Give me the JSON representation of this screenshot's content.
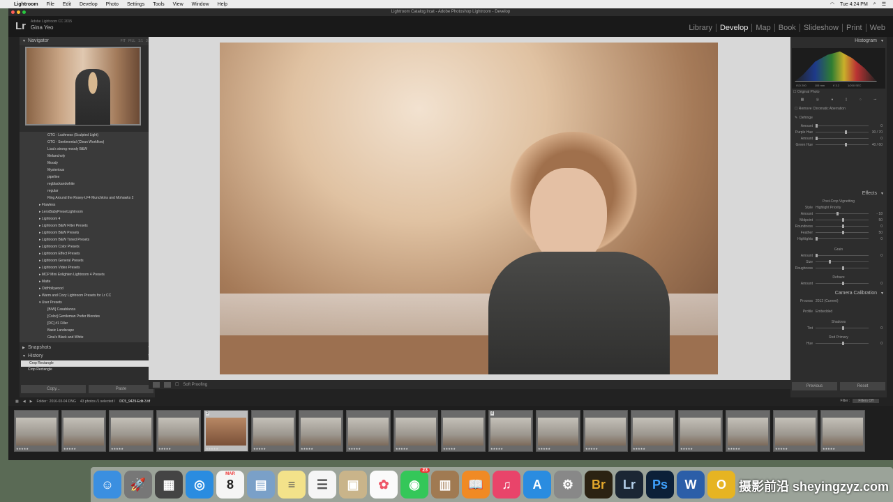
{
  "menubar": {
    "app": "Lightroom",
    "items": [
      "File",
      "Edit",
      "Develop",
      "Photo",
      "Settings",
      "Tools",
      "View",
      "Window",
      "Help"
    ],
    "clock": "Tue 4:24 PM"
  },
  "window_title": "Lightroom Catalog.lrcat - Adobe Photoshop Lightroom - Develop",
  "identity": {
    "logo": "Lr",
    "product": "Adobe Lightroom CC 2015",
    "user": "Gina Yeo"
  },
  "modules": [
    "Library",
    "Develop",
    "Map",
    "Book",
    "Slideshow",
    "Print",
    "Web"
  ],
  "navigator": {
    "title": "Navigator",
    "options": [
      "FIT",
      "FILL",
      "1:1",
      "3:1"
    ]
  },
  "presets": [
    {
      "label": "GTG - Lushness (Sculpted Light)",
      "kind": "sub"
    },
    {
      "label": "GTG - Sentimental (Clean Workflow)",
      "kind": "sub"
    },
    {
      "label": "Lisa's strong moody B&W",
      "kind": "sub"
    },
    {
      "label": "Melancholy",
      "kind": "sub"
    },
    {
      "label": "Moody",
      "kind": "sub"
    },
    {
      "label": "Mysterious",
      "kind": "sub"
    },
    {
      "label": "pipeline",
      "kind": "sub"
    },
    {
      "label": "regblackandwhite",
      "kind": "sub"
    },
    {
      "label": "regular",
      "kind": "sub"
    },
    {
      "label": "Ring Around the Rosey-LF4 Munchkins and Mohawks 2",
      "kind": "sub"
    },
    {
      "label": "▸ Flawless",
      "kind": "fld"
    },
    {
      "label": "▸ LensBabyPresetLightroom",
      "kind": "fld"
    },
    {
      "label": "▸ Lightroom 4",
      "kind": "fld"
    },
    {
      "label": "▸ Lightroom B&W Filter Presets",
      "kind": "fld"
    },
    {
      "label": "▸ Lightroom B&W Presets",
      "kind": "fld"
    },
    {
      "label": "▸ Lightroom B&W Toned Presets",
      "kind": "fld"
    },
    {
      "label": "▸ Lightroom Color Presets",
      "kind": "fld"
    },
    {
      "label": "▸ Lightroom Effect Presets",
      "kind": "fld"
    },
    {
      "label": "▸ Lightroom General Presets",
      "kind": "fld"
    },
    {
      "label": "▸ Lightroom Video Presets",
      "kind": "fld"
    },
    {
      "label": "▸ MCP Mini Enlighten Lightroom 4 Presets",
      "kind": "fld"
    },
    {
      "label": "▸ Matte",
      "kind": "fld"
    },
    {
      "label": "▸ OldHollywood",
      "kind": "fld"
    },
    {
      "label": "▸ Warm and Cozy Lightroom Presets for Lr CC",
      "kind": "fld"
    },
    {
      "label": "▾ User Presets",
      "kind": "fld"
    },
    {
      "label": "[B/W] Casablanca",
      "kind": "sub"
    },
    {
      "label": "[Color] Gentleman Prefer Blondes",
      "kind": "sub"
    },
    {
      "label": "[DC] #1 Filler",
      "kind": "sub"
    },
    {
      "label": "Basic Landscape",
      "kind": "sub"
    },
    {
      "label": "Gina's Black and White",
      "kind": "sub"
    }
  ],
  "snapshots": {
    "title": "Snapshots"
  },
  "history": {
    "title": "History",
    "items": [
      "Crop Rectangle",
      "Crop Rectangle"
    ]
  },
  "leftbuttons": {
    "copy": "Copy...",
    "paste": "Paste"
  },
  "toolbar": {
    "soft_proofing": "Soft Proofing"
  },
  "right": {
    "histogram_title": "Histogram",
    "histogram_info": [
      "ISO 200",
      "105 mm",
      "f/ 3.2",
      "1/200 SEC"
    ],
    "original_photo": "Original Photo",
    "remove_ca": "Remove Chromatic Aberration",
    "defringe": "Defringe",
    "defringe_rows": [
      {
        "label": "Amount",
        "value": "0",
        "pos": 0
      },
      {
        "label": "Purple Hue",
        "value": "30 / 70",
        "pos": 55
      },
      {
        "label": "Amount",
        "value": "0",
        "pos": 0
      },
      {
        "label": "Green Hue",
        "value": "40 / 60",
        "pos": 55
      }
    ],
    "effects_title": "Effects",
    "vignette_title": "Post-Crop Vignetting",
    "vignette_style_label": "Style",
    "vignette_style": "Highlight Priority",
    "vignette_rows": [
      {
        "label": "Amount",
        "value": "- 18",
        "pos": 40
      },
      {
        "label": "Midpoint",
        "value": "50",
        "pos": 50
      },
      {
        "label": "Roundness",
        "value": "0",
        "pos": 50
      },
      {
        "label": "Feather",
        "value": "50",
        "pos": 50
      },
      {
        "label": "Highlights",
        "value": "0",
        "pos": 0
      }
    ],
    "grain_title": "Grain",
    "grain_rows": [
      {
        "label": "Amount",
        "value": "0",
        "pos": 0
      },
      {
        "label": "Size",
        "value": "",
        "pos": 25
      },
      {
        "label": "Roughness",
        "value": "",
        "pos": 50
      }
    ],
    "dehaze_title": "Dehaze",
    "dehaze_row": {
      "label": "Amount",
      "value": "0",
      "pos": 50
    },
    "calibration_title": "Camera Calibration",
    "process_label": "Process",
    "process": "2012 (Current)",
    "profile_label": "Profile",
    "profile": "Embedded",
    "shadows_title": "Shadows",
    "tint_row": {
      "label": "Tint",
      "value": "0",
      "pos": 50
    },
    "red_primary": "Red Primary",
    "hue_row": {
      "label": "Hue",
      "value": "0",
      "pos": 50
    },
    "previous": "Previous",
    "reset": "Reset"
  },
  "filmbar": {
    "folder": "Folder : 2016-03-04 DNG",
    "count": "43 photos /1 selected /",
    "filename": "DC5_9429-Edit-3.tif",
    "filter_label": "Filter :",
    "filter_value": "Filters Off"
  },
  "filmstrip": {
    "stars": "★★★★★",
    "thumbs": [
      {
        "num": ""
      },
      {
        "num": ""
      },
      {
        "num": ""
      },
      {
        "num": ""
      },
      {
        "num": "2",
        "active": true
      },
      {
        "num": ""
      },
      {
        "num": ""
      },
      {
        "num": ""
      },
      {
        "num": ""
      },
      {
        "num": ""
      },
      {
        "num": "4"
      },
      {
        "num": ""
      },
      {
        "num": ""
      },
      {
        "num": ""
      },
      {
        "num": ""
      },
      {
        "num": ""
      },
      {
        "num": ""
      },
      {
        "num": ""
      }
    ]
  },
  "dock": {
    "apps": [
      {
        "name": "finder-icon",
        "glyph": "☺",
        "color": "#3b8fe0"
      },
      {
        "name": "launchpad-icon",
        "glyph": "🚀",
        "color": "#777"
      },
      {
        "name": "mission-control-icon",
        "glyph": "▦",
        "color": "#444"
      },
      {
        "name": "safari-icon",
        "glyph": "◎",
        "color": "#2a8ce0"
      },
      {
        "name": "calendar-icon",
        "glyph": "8",
        "color": "#f5f5f5",
        "text": "#222",
        "label": "MAR"
      },
      {
        "name": "preview-icon",
        "glyph": "▤",
        "color": "#7aa0c8"
      },
      {
        "name": "notes-icon",
        "glyph": "≡",
        "color": "#f3e28a",
        "text": "#555"
      },
      {
        "name": "reminders-icon",
        "glyph": "☰",
        "color": "#f5f5f5",
        "text": "#555"
      },
      {
        "name": "contacts-icon",
        "glyph": "▣",
        "color": "#c9b48a"
      },
      {
        "name": "photos-icon",
        "glyph": "✿",
        "color": "#fafafa",
        "text": "#e56"
      },
      {
        "name": "facetime-icon",
        "glyph": "◉",
        "color": "#34c759",
        "badge": "23"
      },
      {
        "name": "ibooks-icon",
        "glyph": "▥",
        "color": "#a07a52"
      },
      {
        "name": "books-icon",
        "glyph": "📖",
        "color": "#f08a24"
      },
      {
        "name": "itunes-icon",
        "glyph": "♫",
        "color": "#e9446a"
      },
      {
        "name": "app-store-icon",
        "glyph": "A",
        "color": "#2a8ce0"
      },
      {
        "name": "system-preferences-icon",
        "glyph": "⚙",
        "color": "#888"
      },
      {
        "name": "bridge-icon",
        "glyph": "Br",
        "color": "#2b2212",
        "text": "#e3a72b"
      },
      {
        "name": "lightroom-icon",
        "glyph": "Lr",
        "color": "#1b2634",
        "text": "#b5d0ea"
      },
      {
        "name": "photoshop-icon",
        "glyph": "Ps",
        "color": "#0c2038",
        "text": "#3fa2ff"
      },
      {
        "name": "word-icon",
        "glyph": "W",
        "color": "#2b5ea8"
      },
      {
        "name": "office-icon",
        "glyph": "O",
        "color": "#e6b422"
      }
    ]
  },
  "watermark": "摄影前沿 sheyingzyz.com"
}
